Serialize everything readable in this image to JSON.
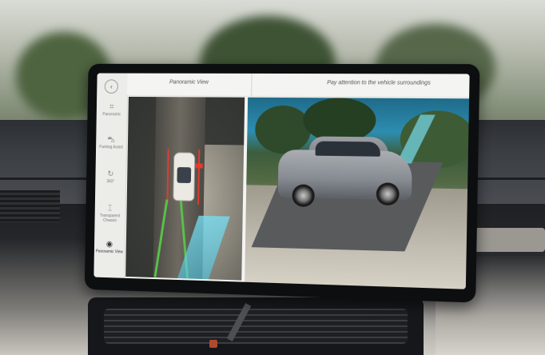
{
  "header": {
    "title": "Panoramic View",
    "message": "Pay attention to the vehicle surroundings"
  },
  "sidebar": {
    "back_icon": "back-icon",
    "items": [
      {
        "label": "Panoramic",
        "icon": "camera-icon",
        "active": false
      },
      {
        "label": "Parking Assist",
        "icon": "car-icon",
        "active": false
      },
      {
        "label": "360°",
        "icon": "rotate-icon",
        "active": false
      },
      {
        "label": "Transparent Chassis",
        "icon": "chassis-icon",
        "active": false
      },
      {
        "label": "Panoramic View",
        "icon": "eye-icon",
        "active": true
      }
    ]
  },
  "colors": {
    "accent_red": "#e23b2f",
    "guide_green": "#58c24a",
    "guide_cyan": "#6fd6ee"
  }
}
